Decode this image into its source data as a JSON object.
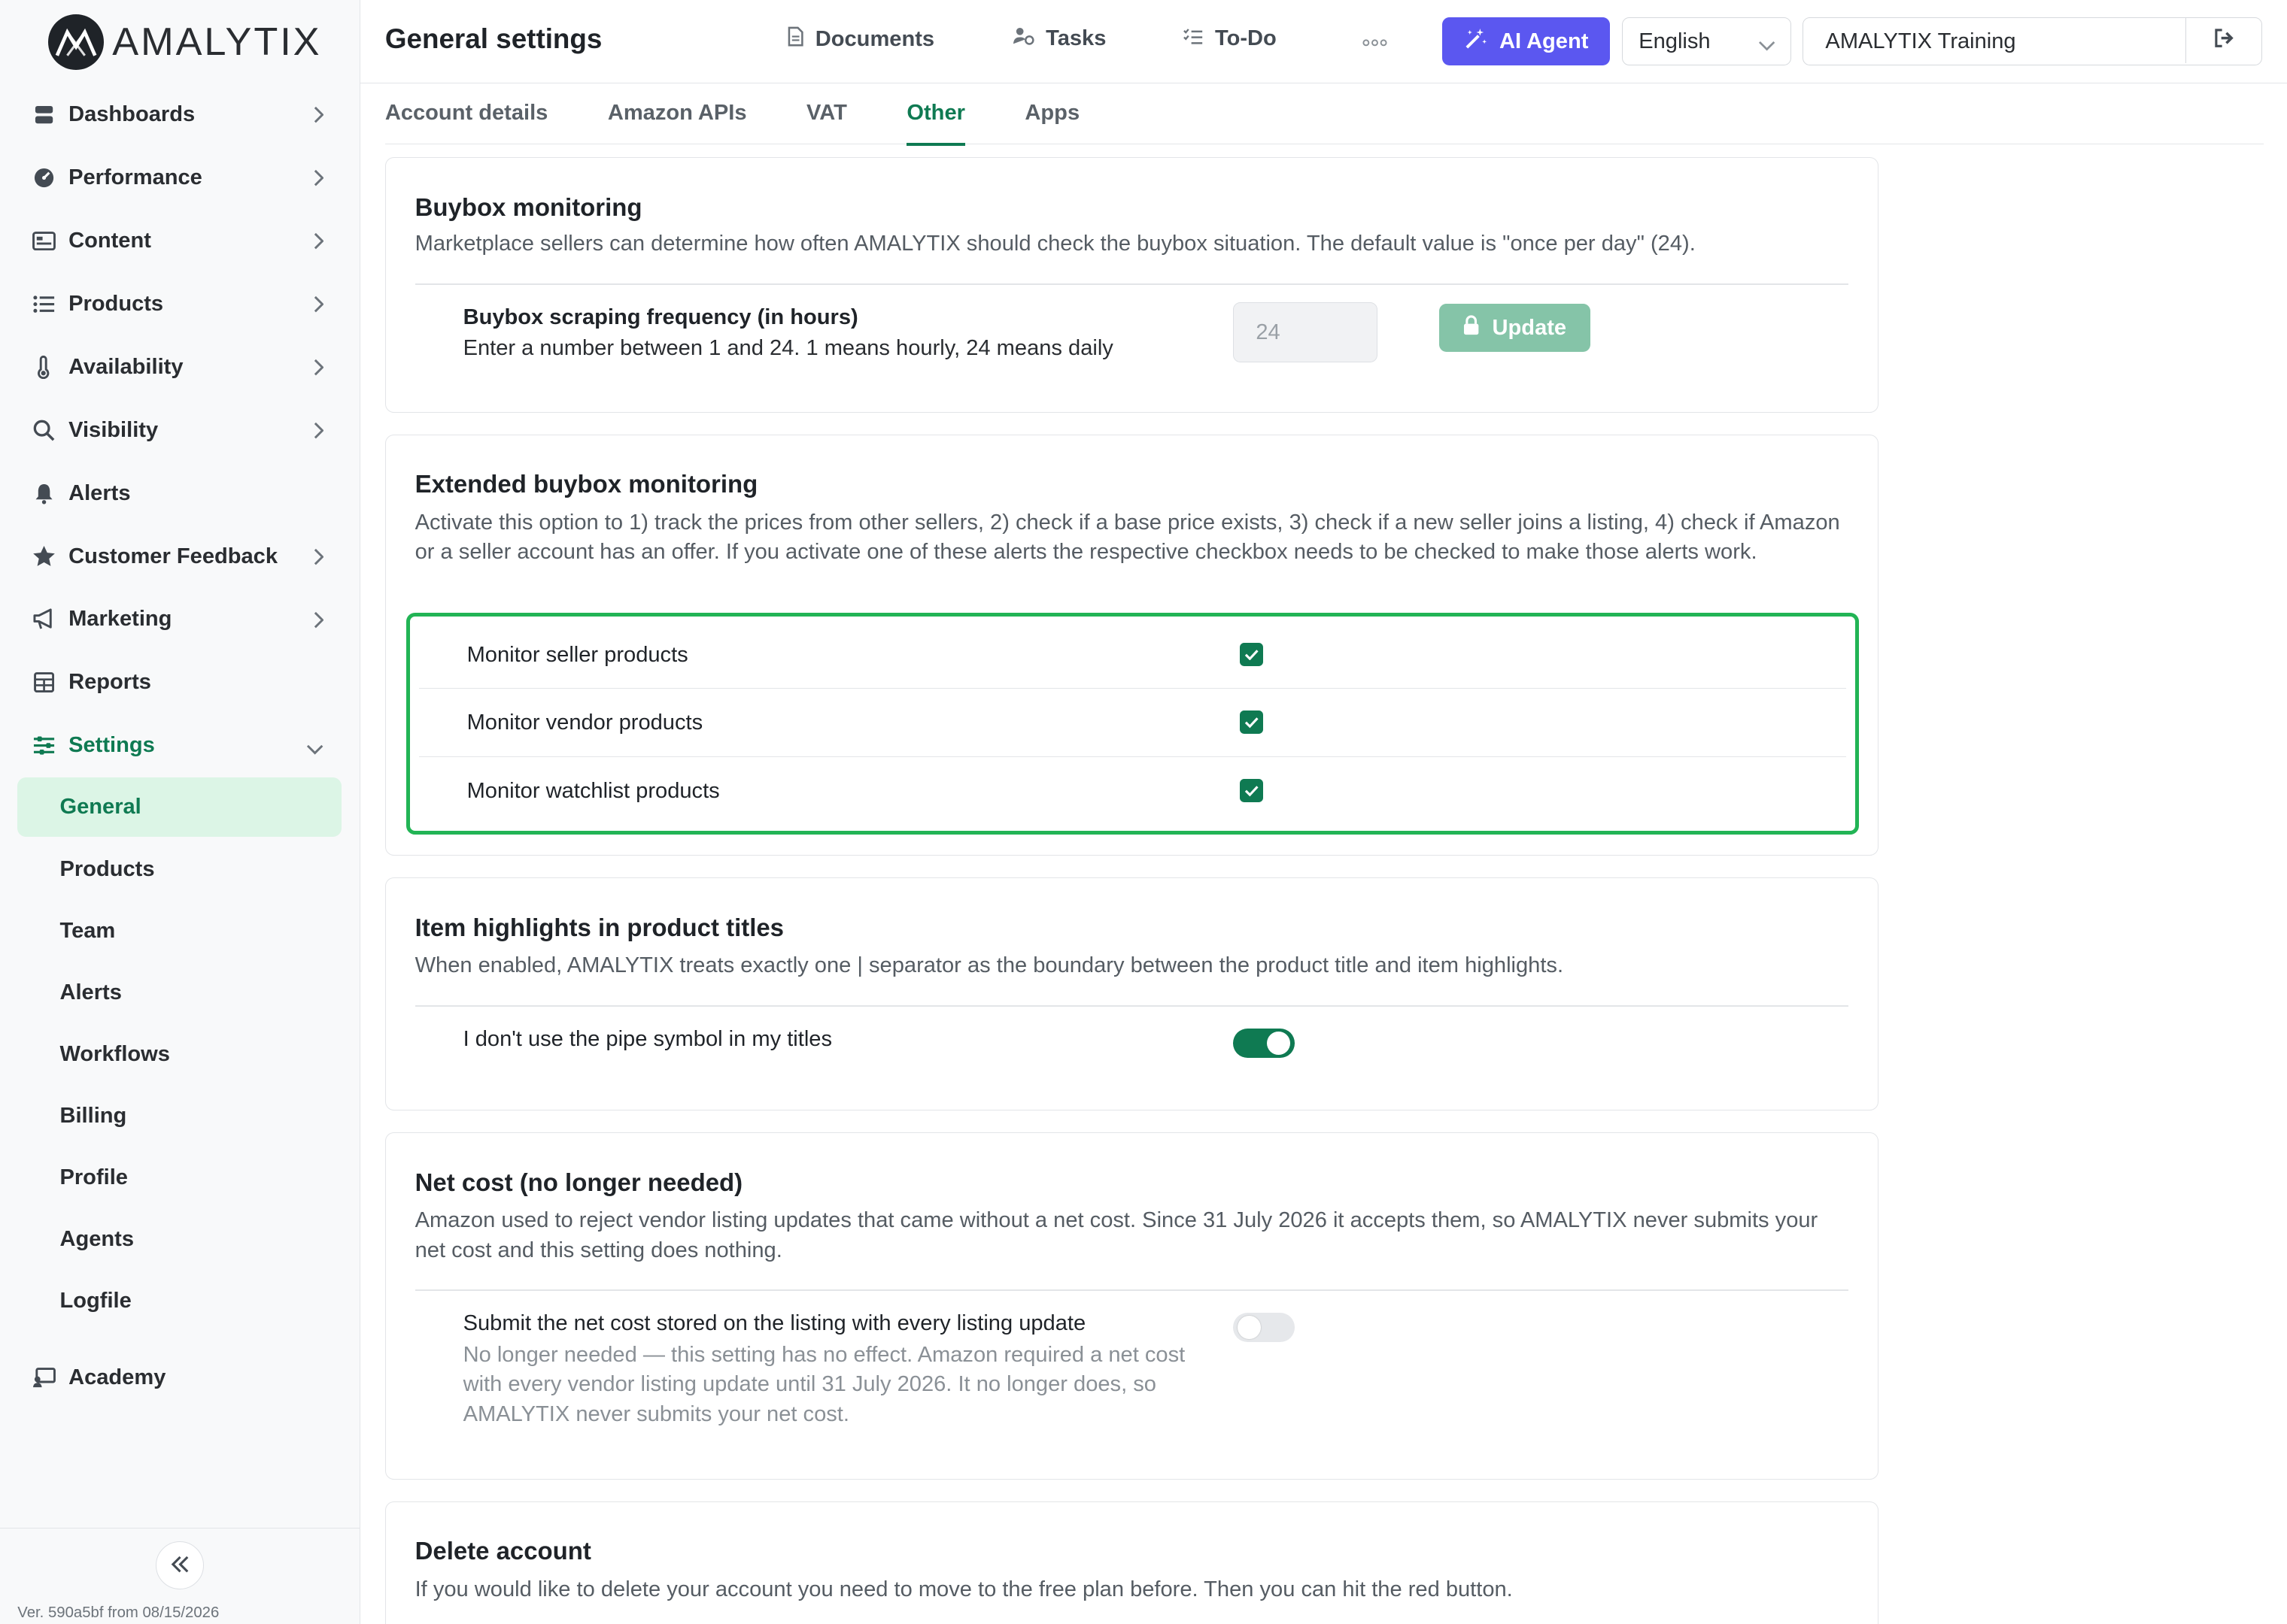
{
  "app": {
    "logo_text": "AMALYTIX",
    "version": "Ver. 590a5bf from 08/15/2026"
  },
  "sidebar": {
    "items": [
      {
        "label": "Dashboards",
        "icon": "dashboard-icon",
        "chevron": true
      },
      {
        "label": "Performance",
        "icon": "performance-icon",
        "chevron": true
      },
      {
        "label": "Content",
        "icon": "content-icon",
        "chevron": true
      },
      {
        "label": "Products",
        "icon": "list-icon",
        "chevron": true
      },
      {
        "label": "Availability",
        "icon": "thermometer-icon",
        "chevron": true
      },
      {
        "label": "Visibility",
        "icon": "search-icon",
        "chevron": true
      },
      {
        "label": "Alerts",
        "icon": "bell-icon",
        "chevron": false
      },
      {
        "label": "Customer Feedback",
        "icon": "star-icon",
        "chevron": true
      },
      {
        "label": "Marketing",
        "icon": "megaphone-icon",
        "chevron": true
      },
      {
        "label": "Reports",
        "icon": "table-icon",
        "chevron": false
      },
      {
        "label": "Settings",
        "icon": "sliders-icon",
        "chevron": true,
        "active": true
      }
    ],
    "settings_sub": [
      {
        "label": "General",
        "active": true
      },
      {
        "label": "Products"
      },
      {
        "label": "Team"
      },
      {
        "label": "Alerts"
      },
      {
        "label": "Workflows"
      },
      {
        "label": "Billing"
      },
      {
        "label": "Profile"
      },
      {
        "label": "Agents"
      },
      {
        "label": "Logfile"
      }
    ],
    "academy": {
      "label": "Academy",
      "icon": "academy-icon"
    }
  },
  "header": {
    "title": "General settings",
    "links": [
      {
        "label": "Documents",
        "icon": "document-icon"
      },
      {
        "label": "Tasks",
        "icon": "tasks-icon"
      },
      {
        "label": "To-Do",
        "icon": "todo-icon"
      }
    ],
    "ai_agent_label": "AI Agent",
    "language": "English",
    "account": "AMALYTIX Training"
  },
  "tabs": [
    {
      "label": "Account details"
    },
    {
      "label": "Amazon APIs"
    },
    {
      "label": "VAT"
    },
    {
      "label": "Other",
      "active": true
    },
    {
      "label": "Apps"
    }
  ],
  "buybox": {
    "title": "Buybox monitoring",
    "description": "Marketplace sellers can determine how often AMALYTIX should check the buybox situation. The default value is \"once per day\" (24).",
    "freq_label": "Buybox scraping frequency (in hours)",
    "freq_help": "Enter a number between 1 and 24. 1 means hourly, 24 means daily",
    "freq_value": "24",
    "update_label": "Update"
  },
  "extended": {
    "title": "Extended buybox monitoring",
    "description": "Activate this option to 1) track the prices from other sellers, 2) check if a base price exists, 3) check if a new seller joins a listing, 4) check if Amazon or a seller account has an offer. If you activate one of these alerts the respective checkbox needs to be checked to make those alerts work.",
    "options": [
      {
        "label": "Monitor seller products",
        "checked": true
      },
      {
        "label": "Monitor vendor products",
        "checked": true
      },
      {
        "label": "Monitor watchlist products",
        "checked": true
      }
    ]
  },
  "highlights": {
    "title": "Item highlights in product titles",
    "description": "When enabled, AMALYTIX treats exactly one | separator as the boundary between the product title and item highlights.",
    "toggle_label": "I don't use the pipe symbol in my titles",
    "toggle_on": true
  },
  "netcost": {
    "title": "Net cost (no longer needed)",
    "description": "Amazon used to reject vendor listing updates that came without a net cost. Since 31 July 2026 it accepts them, so AMALYTIX never submits your net cost and this setting does nothing.",
    "toggle_label": "Submit the net cost stored on the listing with every listing update",
    "toggle_help": "No longer needed — this setting has no effect. Amazon required a net cost with every vendor listing update until 31 July 2026. It no longer does, so AMALYTIX never submits your net cost.",
    "toggle_on": false
  },
  "delete": {
    "title": "Delete account",
    "description": "If you would like to delete your account you need to move to the free plan before. Then you can hit the red button."
  },
  "colors": {
    "brand_green": "#0f7a52",
    "ai_purple": "#5b57f0",
    "highlight": "#22b455"
  }
}
